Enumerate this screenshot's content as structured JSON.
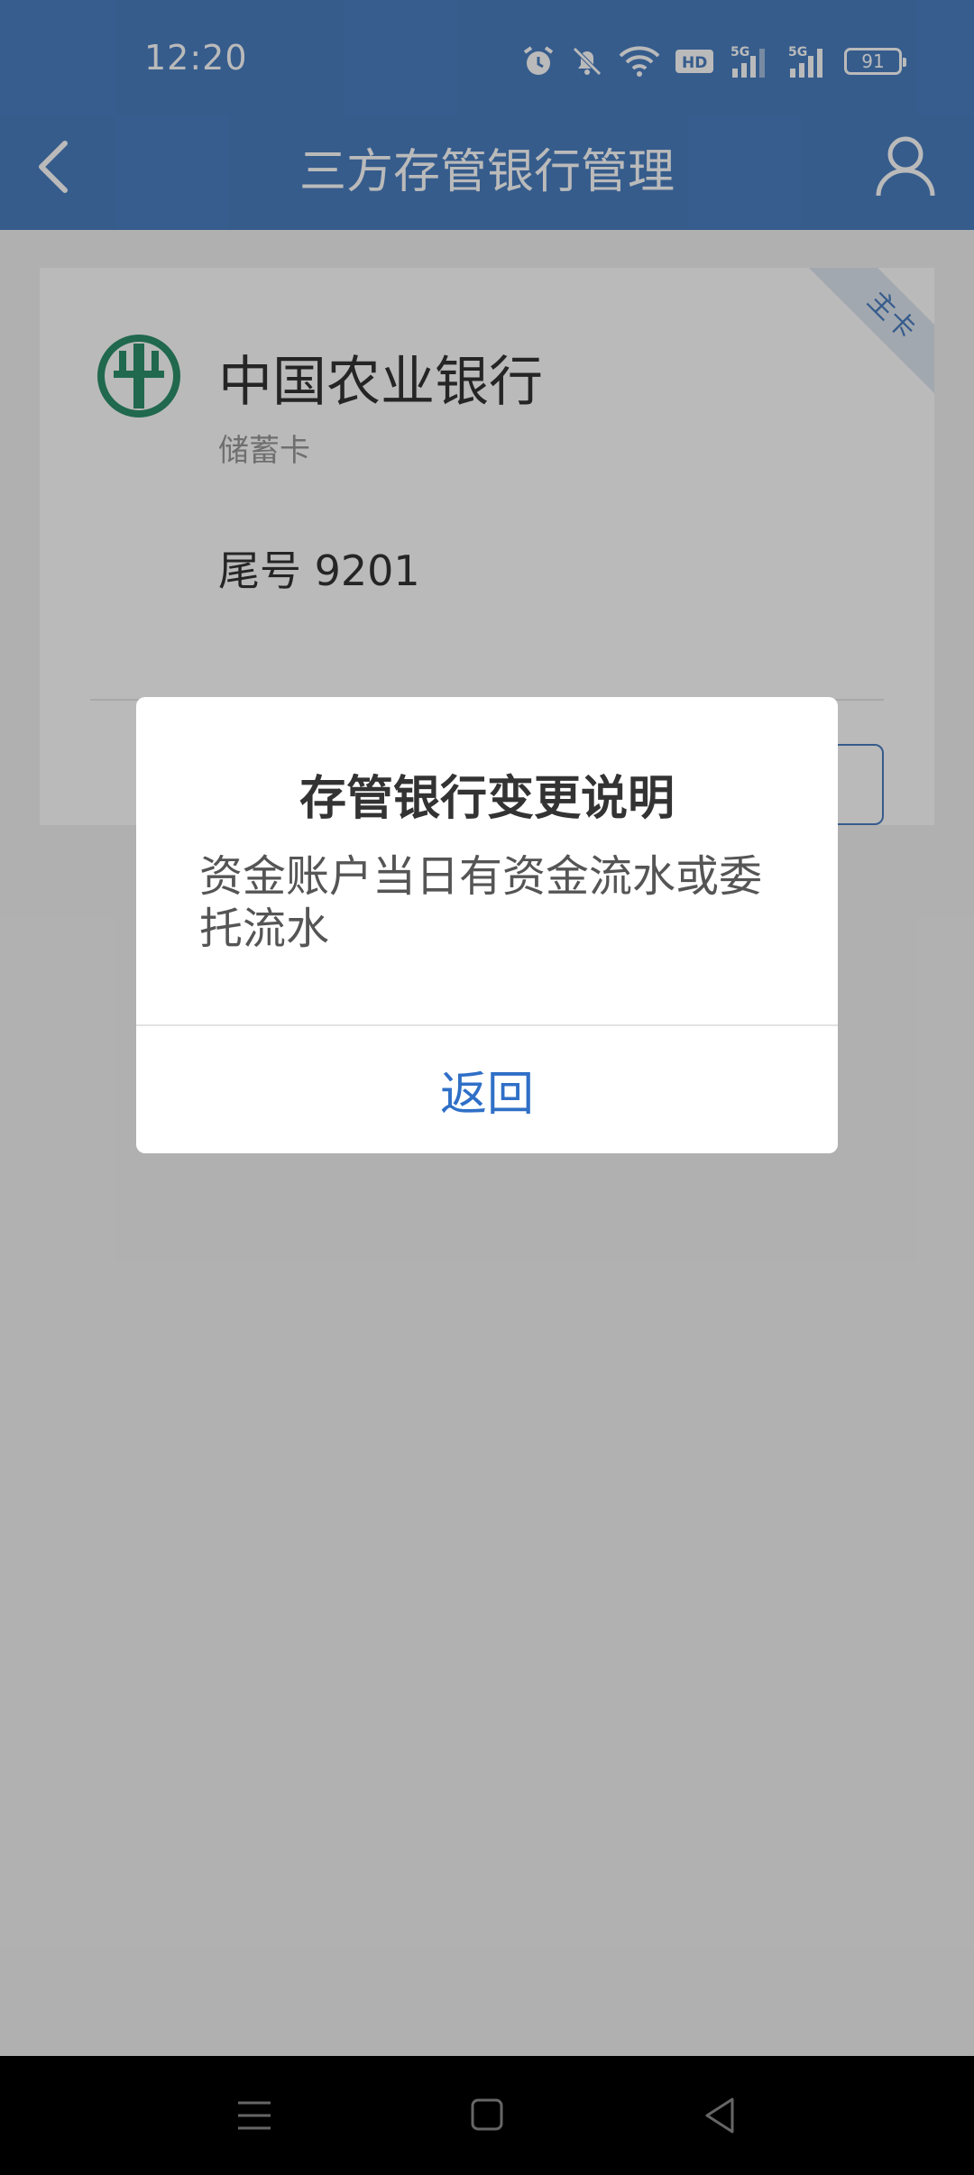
{
  "status": {
    "time": "12:20",
    "battery": "91",
    "icons": [
      "alarm-icon",
      "bell-off-icon",
      "wifi-icon",
      "hd-icon",
      "signal-5g-icon",
      "signal-5g-icon",
      "battery-icon"
    ]
  },
  "header": {
    "title": "三方存管银行管理",
    "back_icon": "chevron-left-icon",
    "user_icon": "user-icon"
  },
  "card": {
    "bank_name": "中国农业银行",
    "card_type": "储蓄卡",
    "tail_number": "尾号 9201",
    "ribbon": "主卡",
    "logo_color": "#2c8f6b"
  },
  "dialog": {
    "title": "存管银行变更说明",
    "message": "资金账户当日有资金流水或委托流水",
    "button": "返回"
  },
  "colors": {
    "accent": "#4a7fc1",
    "link": "#2f6fc7"
  }
}
